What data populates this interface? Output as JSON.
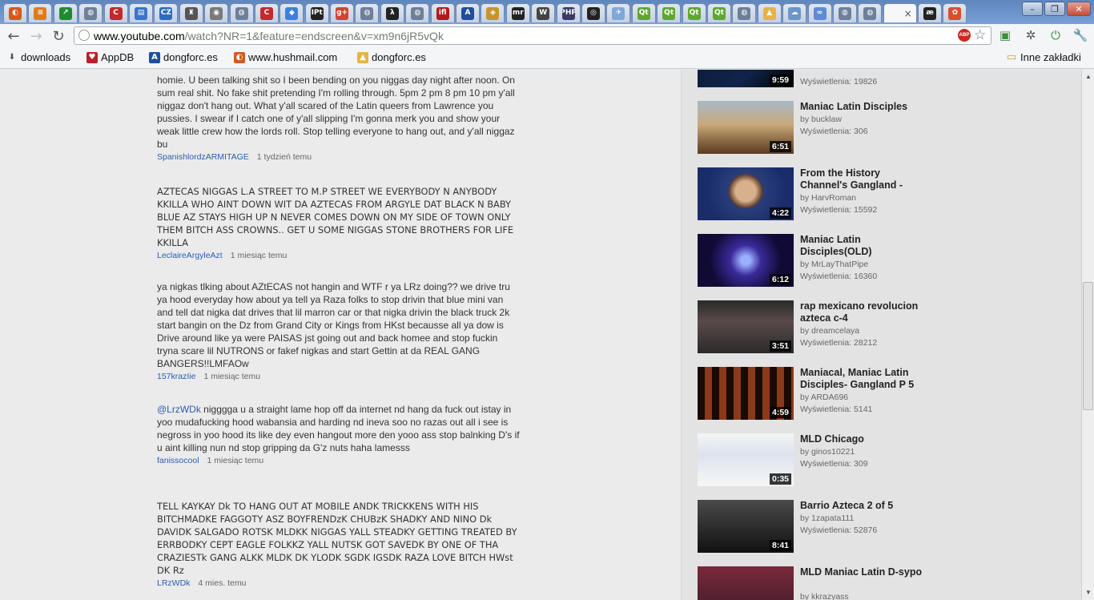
{
  "browser": {
    "tabs": [
      {
        "icon": "opera-icon",
        "letter": "◐",
        "color": "#d8581c"
      },
      {
        "icon": "stack-icon",
        "letter": "≡",
        "color": "#e07b1a"
      },
      {
        "icon": "arrow-icon",
        "letter": "↗",
        "color": "#1e8a2e"
      },
      {
        "icon": "globe-icon",
        "letter": "◍",
        "color": "#6d7f99"
      },
      {
        "icon": "c-icon",
        "letter": "C",
        "color": "#c42a2a"
      },
      {
        "icon": "calendar-icon",
        "letter": "▤",
        "color": "#3b74c9"
      },
      {
        "icon": "cz-icon",
        "letter": "CZ",
        "color": "#2c6bbd"
      },
      {
        "icon": "crest-icon",
        "letter": "♜",
        "color": "#555555"
      },
      {
        "icon": "disc-icon",
        "letter": "◉",
        "color": "#7a7a7a"
      },
      {
        "icon": "globe-icon",
        "letter": "◍",
        "color": "#6d7f99"
      },
      {
        "icon": "c-icon",
        "letter": "C",
        "color": "#c42a2a"
      },
      {
        "icon": "map-icon",
        "letter": "◆",
        "color": "#3f7fd9"
      },
      {
        "icon": "ipt-icon",
        "letter": "IPt",
        "color": "#222222"
      },
      {
        "icon": "gplus-icon",
        "letter": "g+",
        "color": "#d3422e"
      },
      {
        "icon": "globe-icon",
        "letter": "◍",
        "color": "#6d7f99"
      },
      {
        "icon": "lambda-icon",
        "letter": "λ",
        "color": "#222222"
      },
      {
        "icon": "globe-icon",
        "letter": "◍",
        "color": "#6d7f99"
      },
      {
        "icon": "ifl-icon",
        "letter": "ifl",
        "color": "#b51818"
      },
      {
        "icon": "a-icon",
        "letter": "A",
        "color": "#1f4f9c"
      },
      {
        "icon": "shield-icon",
        "letter": "◈",
        "color": "#c9932a"
      },
      {
        "icon": "mr-icon",
        "letter": "mr",
        "color": "#222222"
      },
      {
        "icon": "wikipedia-icon",
        "letter": "W",
        "color": "#444444"
      },
      {
        "icon": "php-icon",
        "letter": "PHP",
        "color": "#3a3a66"
      },
      {
        "icon": "camera-icon",
        "letter": "◎",
        "color": "#222222"
      },
      {
        "icon": "bird-icon",
        "letter": "✈",
        "color": "#7fa7d8"
      },
      {
        "icon": "qt-icon",
        "letter": "Qt",
        "color": "#5da82d"
      },
      {
        "icon": "qt-icon",
        "letter": "Qt",
        "color": "#5da82d"
      },
      {
        "icon": "qt-icon",
        "letter": "Qt",
        "color": "#5da82d"
      },
      {
        "icon": "qt-icon",
        "letter": "Qt",
        "color": "#5da82d"
      },
      {
        "icon": "globe-icon",
        "letter": "◍",
        "color": "#6d7f99"
      },
      {
        "icon": "doc-icon",
        "letter": "▲",
        "color": "#e7b24a"
      },
      {
        "icon": "cloud-icon",
        "letter": "☁",
        "color": "#6a96c8"
      },
      {
        "icon": "rings-icon",
        "letter": "∞",
        "color": "#5c8bd6"
      },
      {
        "icon": "globe-icon",
        "letter": "◍",
        "color": "#6d7f99"
      },
      {
        "icon": "globe-icon",
        "letter": "◍",
        "color": "#6d7f99"
      }
    ],
    "active_tab_close": "×",
    "after_tabs": [
      {
        "icon": "ae-icon",
        "letter": "æ",
        "color": "#222222"
      },
      {
        "icon": "nbc-icon",
        "letter": "✿",
        "color": "#d94f2a"
      }
    ],
    "window_controls": {
      "minimize": "–",
      "maximize": "❐",
      "close": "✕"
    },
    "url_host": "www.youtube.com",
    "url_rest": "/watch?NR=1&feature=endscreen&v=xm9n6jR5vQk",
    "abp_label": "ABP",
    "bookmarks": [
      {
        "label": "downloads",
        "icon": "download-icon",
        "glyph": "⬇",
        "color": "#555555"
      },
      {
        "label": "AppDB",
        "icon": "appdb-icon",
        "glyph": "♥",
        "color": "#b8212a"
      },
      {
        "label": "dongforc.es",
        "icon": "a-icon",
        "glyph": "A",
        "color": "#1f4f9c"
      },
      {
        "label": "www.hushmail.com",
        "icon": "hushmail-icon",
        "glyph": "◐",
        "color": "#d8581c"
      },
      {
        "label": "dongforc.es",
        "icon": "doc-icon",
        "glyph": "▲",
        "color": "#e7b24a"
      }
    ],
    "other_bookmarks": "Inne zakładki"
  },
  "comments": [
    {
      "text": "homie. U been talking shit so I been bending on you niggas day night after noon. On sum real shit. No fake shit pretending I'm rolling through. 5pm 2 pm 8 pm 10 pm y'all niggaz don't hang out. What y'all scared of the Latin queers from Lawrence you pussies. I swear if I catch one of y'all slipping I'm gonna merk you and show your weak little crew how the lords roll. Stop telling everyone to hang out, and y'all niggaz bu",
      "user": "SpanishlordzARMITAGE",
      "time": "1 tydzień temu"
    },
    {
      "text": "AZTECAS NIGGAS L.A STREET TO M.P STREET WE EVERYBODY N ANYBODY KKILLA WHO AINT DOWN WIT DA AZTECAS FROM ARGYLE DAT BLACK N BABY BLUE AZ STAYS HIGH UP N NEVER COMES DOWN ON MY SIDE OF TOWN ONLY THEM BITCH ASS CROWNS.. GET U SOME NIGGAS STONE BROTHERS FOR LIFE KKILLA",
      "user": "LeclaireArgyleAzt",
      "time": "1 miesiąc temu"
    },
    {
      "text": "ya nigkas tlking about AZtECAS not hangin and WTF r ya LRz doing?? we drive tru ya hood everyday how about ya tell ya Raza folks to stop drivin that blue mini van and tell dat nigka dat drives that lil marron car or that nigka drivin the black truck 2k start bangin on the Dz from Grand City or Kings from HKst becausse all ya dow is Drive around like ya were PAISAS jst going out and back homee and stop fuckin tryna scare lil NUTRONS or fakef nigkas and start Gettin at da REAL GANG BANGERS!!LMFAOw",
      "user": "157krazIie",
      "time": "1 miesiąc temu"
    },
    {
      "mention": "@LrzWDk",
      "text": " nigggga u a straight lame hop off da internet nd hang da fuck out istay in yoo mudafucking hood wabansia and harding nd ineva soo no razas out all i see is negross in yoo hood its like dey even hangout more den yooo ass stop balnking D's if u aint killing nun nd stop gripping da G'z nuts haha lamesss",
      "user": "fanissocool",
      "time": "1 miesiąc temu"
    },
    {
      "text": "TELL KAYKAY Dk TO HANG OUT AT MOBILE ANDK TRICKKENS WITH HIS BITCHMADKE FAGGOTY ASZ BOYFRENDzK CHUBzK SHADKY AND NINO Dk DAVIDK SALGADO ROTSK MLDKK NIGGAS YALL STEADKY GETTING TREATED BY ERRBODKY CEPT EAGLE FOLKKZ YALL NUTSK GOT SAVEDK BY ONE OF THA CRAZIESTk GANG ALKK MLDK DK YLODK SGDK IGSDK RAZA LOVE BITCH HWst DK Rz",
      "user": "LRzWDk",
      "time": "4 mies. temu"
    }
  ],
  "related": [
    {
      "title": "",
      "by": "",
      "views": "Wyświetlenia: 19826",
      "duration": "9:59"
    },
    {
      "title": "Maniac Latin Disciples",
      "by": "by bucklaw",
      "views": "Wyświetlenia: 306",
      "duration": "6:51"
    },
    {
      "title": "From the History Channel's Gangland -",
      "by": "by HarvRoman",
      "views": "Wyświetlenia: 15592",
      "duration": "4:22"
    },
    {
      "title": "Maniac Latin Disciples(OLD)",
      "by": "by MrLayThatPipe",
      "views": "Wyświetlenia: 16360",
      "duration": "6:12"
    },
    {
      "title": "rap mexicano revolucion azteca c-4",
      "by": "by dreamcelaya",
      "views": "Wyświetlenia: 28212",
      "duration": "3:51"
    },
    {
      "title": "Maniacal, Maniac Latin Disciples- Gangland P 5",
      "by": "by ARDA696",
      "views": "Wyświetlenia: 5141",
      "duration": "4:59"
    },
    {
      "title": "MLD Chicago",
      "by": "by ginos10221",
      "views": "Wyświetlenia: 309",
      "duration": "0:35"
    },
    {
      "title": "Barrio Azteca 2 of 5",
      "by": "by 1zapata111",
      "views": "Wyświetlenia: 52876",
      "duration": "8:41"
    },
    {
      "title": "MLD Maniac Latin D-sypo",
      "by": "by kkrazyass",
      "views": "",
      "duration": ""
    }
  ]
}
